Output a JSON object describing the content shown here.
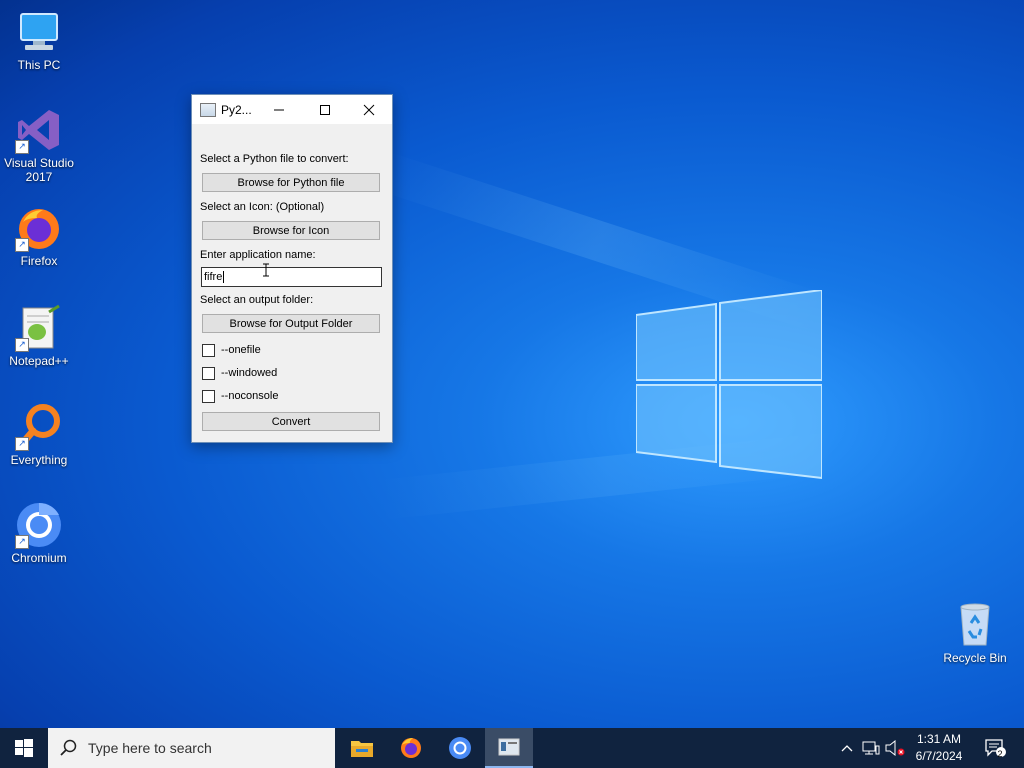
{
  "desktop": {
    "icons": [
      {
        "label": "This PC"
      },
      {
        "label": "Visual Studio 2017"
      },
      {
        "label": "Firefox"
      },
      {
        "label": "Notepad++"
      },
      {
        "label": "Everything"
      },
      {
        "label": "Chromium"
      },
      {
        "label": "Recycle Bin"
      }
    ]
  },
  "window": {
    "title": "Py2...",
    "labels": {
      "select_file": "Select a Python file to convert:",
      "select_icon": "Select an Icon: (Optional)",
      "app_name": "Enter application name:",
      "output_folder": "Select an output folder:"
    },
    "buttons": {
      "browse_python": "Browse for Python file",
      "browse_icon": "Browse for Icon",
      "browse_output": "Browse for Output Folder",
      "convert": "Convert"
    },
    "app_name_value": "fifre",
    "checkboxes": [
      {
        "label": "--onefile",
        "checked": false
      },
      {
        "label": "--windowed",
        "checked": false
      },
      {
        "label": "--noconsole",
        "checked": false
      }
    ]
  },
  "taskbar": {
    "search_placeholder": "Type here to search",
    "time": "1:31 AM",
    "date": "6/7/2024",
    "notification_count": "2"
  }
}
